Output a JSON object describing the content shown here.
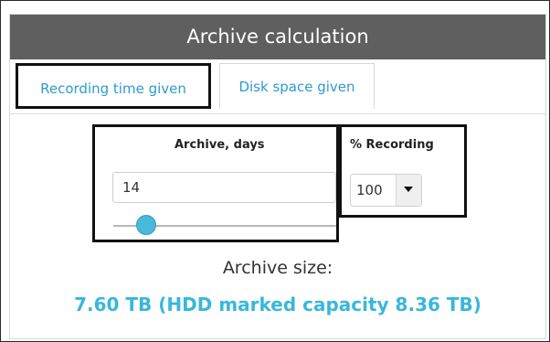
{
  "window": {
    "title": "Archive calculation"
  },
  "tabs": [
    {
      "label": "Recording time given"
    },
    {
      "label": "Disk space given"
    }
  ],
  "archive_days": {
    "label": "Archive, days",
    "value": "14",
    "slider_fraction": 0.14
  },
  "recording": {
    "label": "% Recording",
    "selected": "100"
  },
  "result": {
    "label": "Archive size:",
    "value": "7.60 TB (HDD marked capacity 8.36 TB)"
  },
  "colors": {
    "header_background": "#5f5f5f",
    "accent_blue": "#39b7dc",
    "highlight_border": "#111111"
  },
  "icons": {
    "dropdown": "chevron-down-icon"
  }
}
